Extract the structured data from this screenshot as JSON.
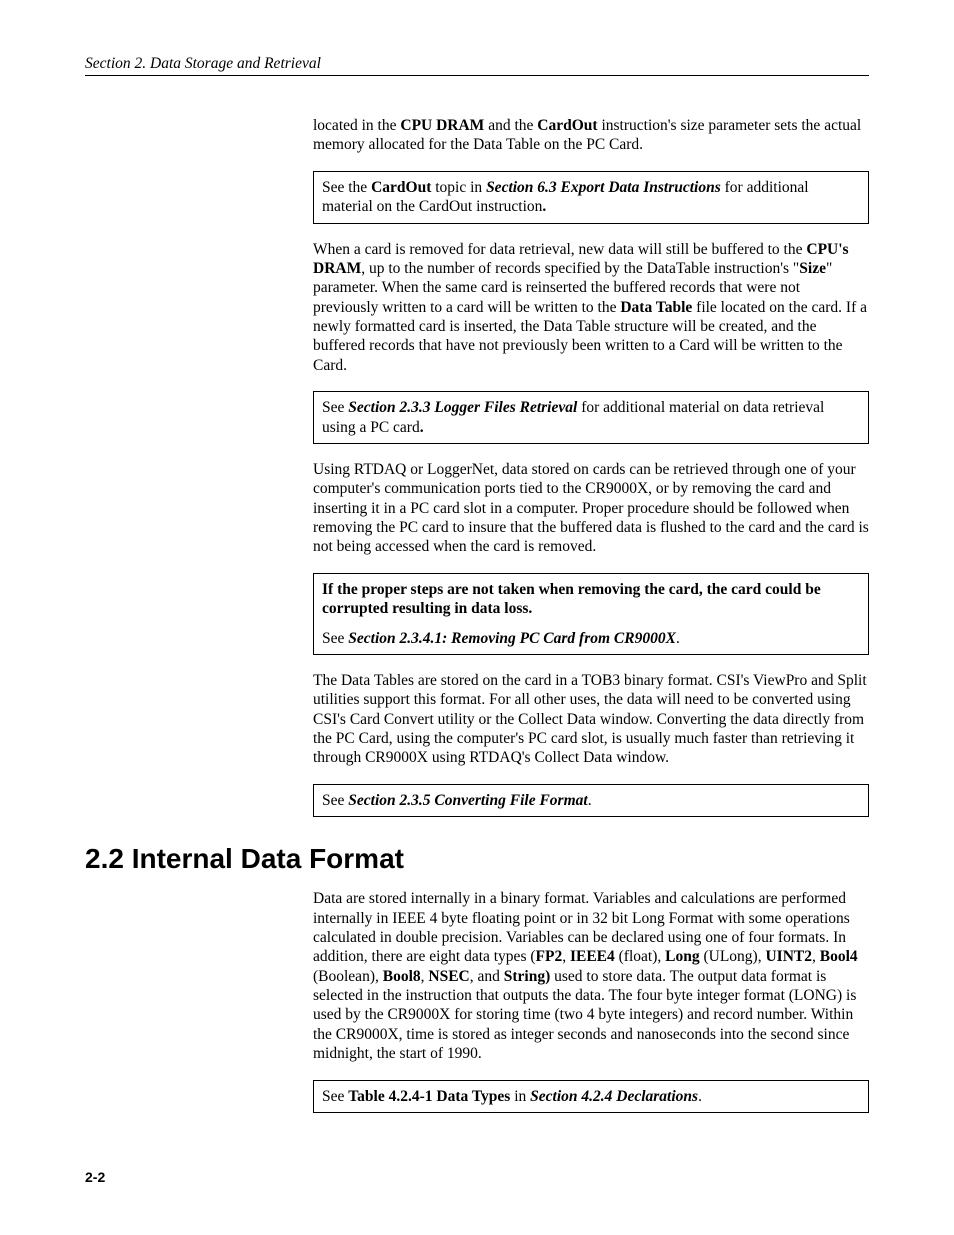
{
  "header": {
    "running_head": "Section 2.  Data Storage and Retrieval"
  },
  "content": {
    "p1_a": "located in the ",
    "p1_b": "CPU DRAM",
    "p1_c": " and the ",
    "p1_d": "CardOut",
    "p1_e": " instruction's size parameter sets the actual memory allocated for the Data Table on the PC Card.",
    "box1_a": "See the ",
    "box1_b": "CardOut",
    "box1_c": " topic in ",
    "box1_d": "Section 6.3 Export Data Instructions",
    "box1_e": " for additional material on the CardOut instruction",
    "box1_f": ".",
    "p2_a": "When a card is removed for data retrieval, new data will still be buffered to the ",
    "p2_b": "CPU's DRAM",
    "p2_c": ", up to the number of records specified by the DataTable instruction's \"",
    "p2_d": "Size",
    "p2_e": "\" parameter.  When the same card is reinserted the buffered records that were not previously written to a card will be written to the ",
    "p2_f": "Data Table",
    "p2_g": " file located on the card.  If a newly formatted card is inserted, the Data Table structure will be created, and the buffered records that have not previously been written to a Card will be written to the Card.",
    "box2_a": "See ",
    "box2_b": "Section 2.3.3  Logger Files Retrieval",
    "box2_c": " for additional  material on data retrieval using a PC card",
    "box2_d": ".",
    "p3": "Using RTDAQ or LoggerNet, data stored on cards can be retrieved through one of your computer's communication ports tied to the CR9000X, or by removing the card and inserting it in a PC card slot in a computer.  Proper procedure should be followed when removing the PC card to insure that the buffered data is flushed to the card and the card is not being accessed when the card is removed.",
    "box3_p1": "If the proper steps are not taken when removing the card, the card could be corrupted resulting in data loss.",
    "box3_p2_a": "See ",
    "box3_p2_b": "Section 2.3.4.1:  Removing PC Card from CR9000X",
    "box3_p2_c": ".",
    "p4": "The Data Tables are stored on the card in a TOB3 binary format.  CSI's ViewPro and Split utilities support this format.  For all other uses, the data will need to be converted using CSI's Card Convert utility or the Collect Data window. Converting the data directly from the PC Card, using the computer's PC card slot, is usually much faster than retrieving it through CR9000X using RTDAQ's Collect Data window.",
    "box4_a": "See ",
    "box4_b": "Section 2.3.5 Converting File Format",
    "box4_c": ".",
    "h2": "2.2  Internal Data Format",
    "p5_a": "Data are stored internally in a binary format.  Variables and calculations are performed internally in IEEE 4 byte floating point or in 32 bit Long Format with some operations calculated in double precision.  Variables can be declared using one of four formats.  In addition, there are eight data types (",
    "p5_b": "FP2",
    "p5_c": ", ",
    "p5_d": "IEEE4",
    "p5_e": " (float), ",
    "p5_f": "Long",
    "p5_g": " (ULong), ",
    "p5_h": "UINT2",
    "p5_i": ", ",
    "p5_j": "Bool4",
    "p5_k": " (Boolean), ",
    "p5_l": "Bool8",
    "p5_m": ", ",
    "p5_n": "NSEC",
    "p5_o": ", and ",
    "p5_p": "String)",
    "p5_q": " used to store data.  The output data format is selected in the instruction that outputs the data.  The four byte integer format (LONG) is used by the CR9000X for storing time (two 4 byte integers) and record number.  Within the CR9000X, time is stored as integer seconds and nanoseconds into the second since midnight, the start of 1990.",
    "box5_a": "See ",
    "box5_b": "Table 4.2.4-1 Data Types",
    "box5_c": " in ",
    "box5_d": "Section 4.2.4 Declarations",
    "box5_e": "."
  },
  "footer": {
    "page_number": "2-2"
  }
}
